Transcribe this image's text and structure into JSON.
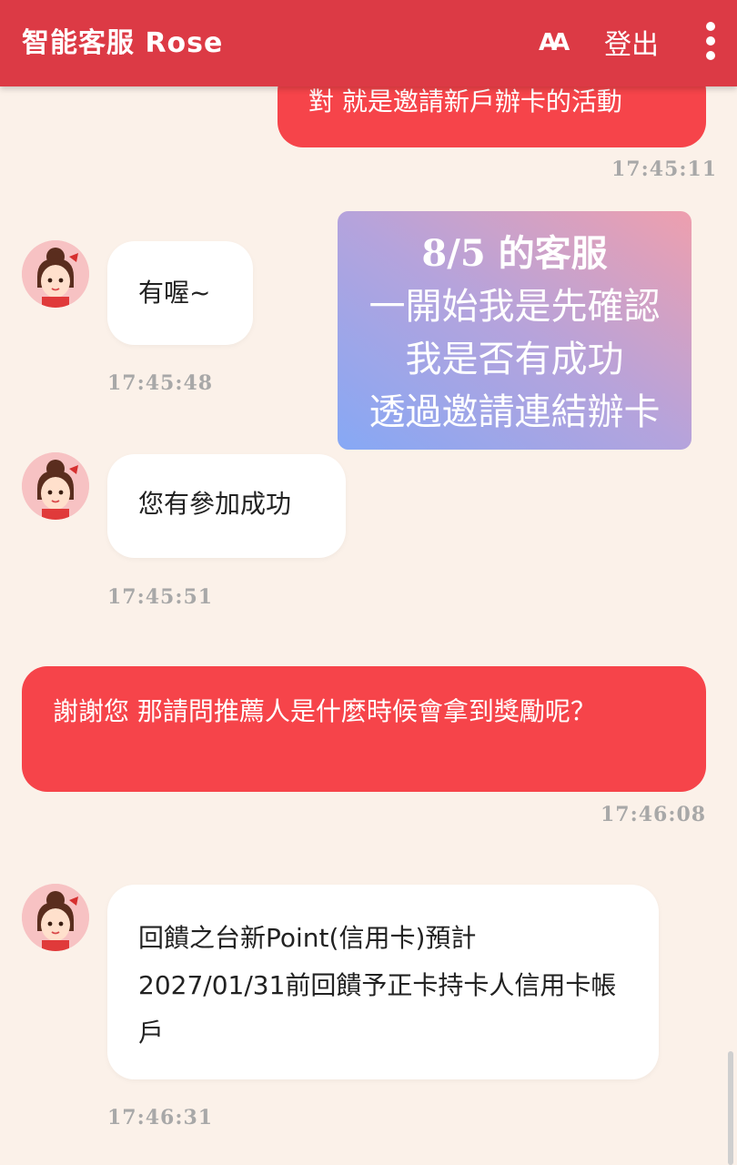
{
  "header": {
    "title": "智能客服 Rose",
    "font_size_icon": "AA",
    "logout_label": "登出",
    "more_icon": "more-vertical-icon"
  },
  "messages": [
    {
      "sender": "user",
      "text": "對 就是邀請新戶辦卡的活動",
      "time": "17:45:11"
    },
    {
      "sender": "bot",
      "text": "有喔~",
      "time": "17:45:48"
    },
    {
      "sender": "bot",
      "text": "您有參加成功",
      "time": "17:45:51"
    },
    {
      "sender": "user",
      "text": "謝謝您 那請問推薦人是什麼時候會拿到獎勵呢？",
      "time": "17:46:08"
    },
    {
      "sender": "bot",
      "text": "回饋之台新Point(信用卡)預計2027/01/31前回饋予正卡持卡人信用卡帳戶",
      "time": "17:46:31"
    }
  ],
  "overlay_note": {
    "lines": [
      "8/5 的客服",
      "一開始我是先確認",
      "我是否有成功",
      "透過邀請連結辦卡"
    ]
  },
  "colors": {
    "header_bg": "#dc3a45",
    "user_bubble": "#f6444a",
    "bot_bubble": "#ffffff",
    "background": "#fbf1e9",
    "timestamp": "#a8a8a8"
  }
}
